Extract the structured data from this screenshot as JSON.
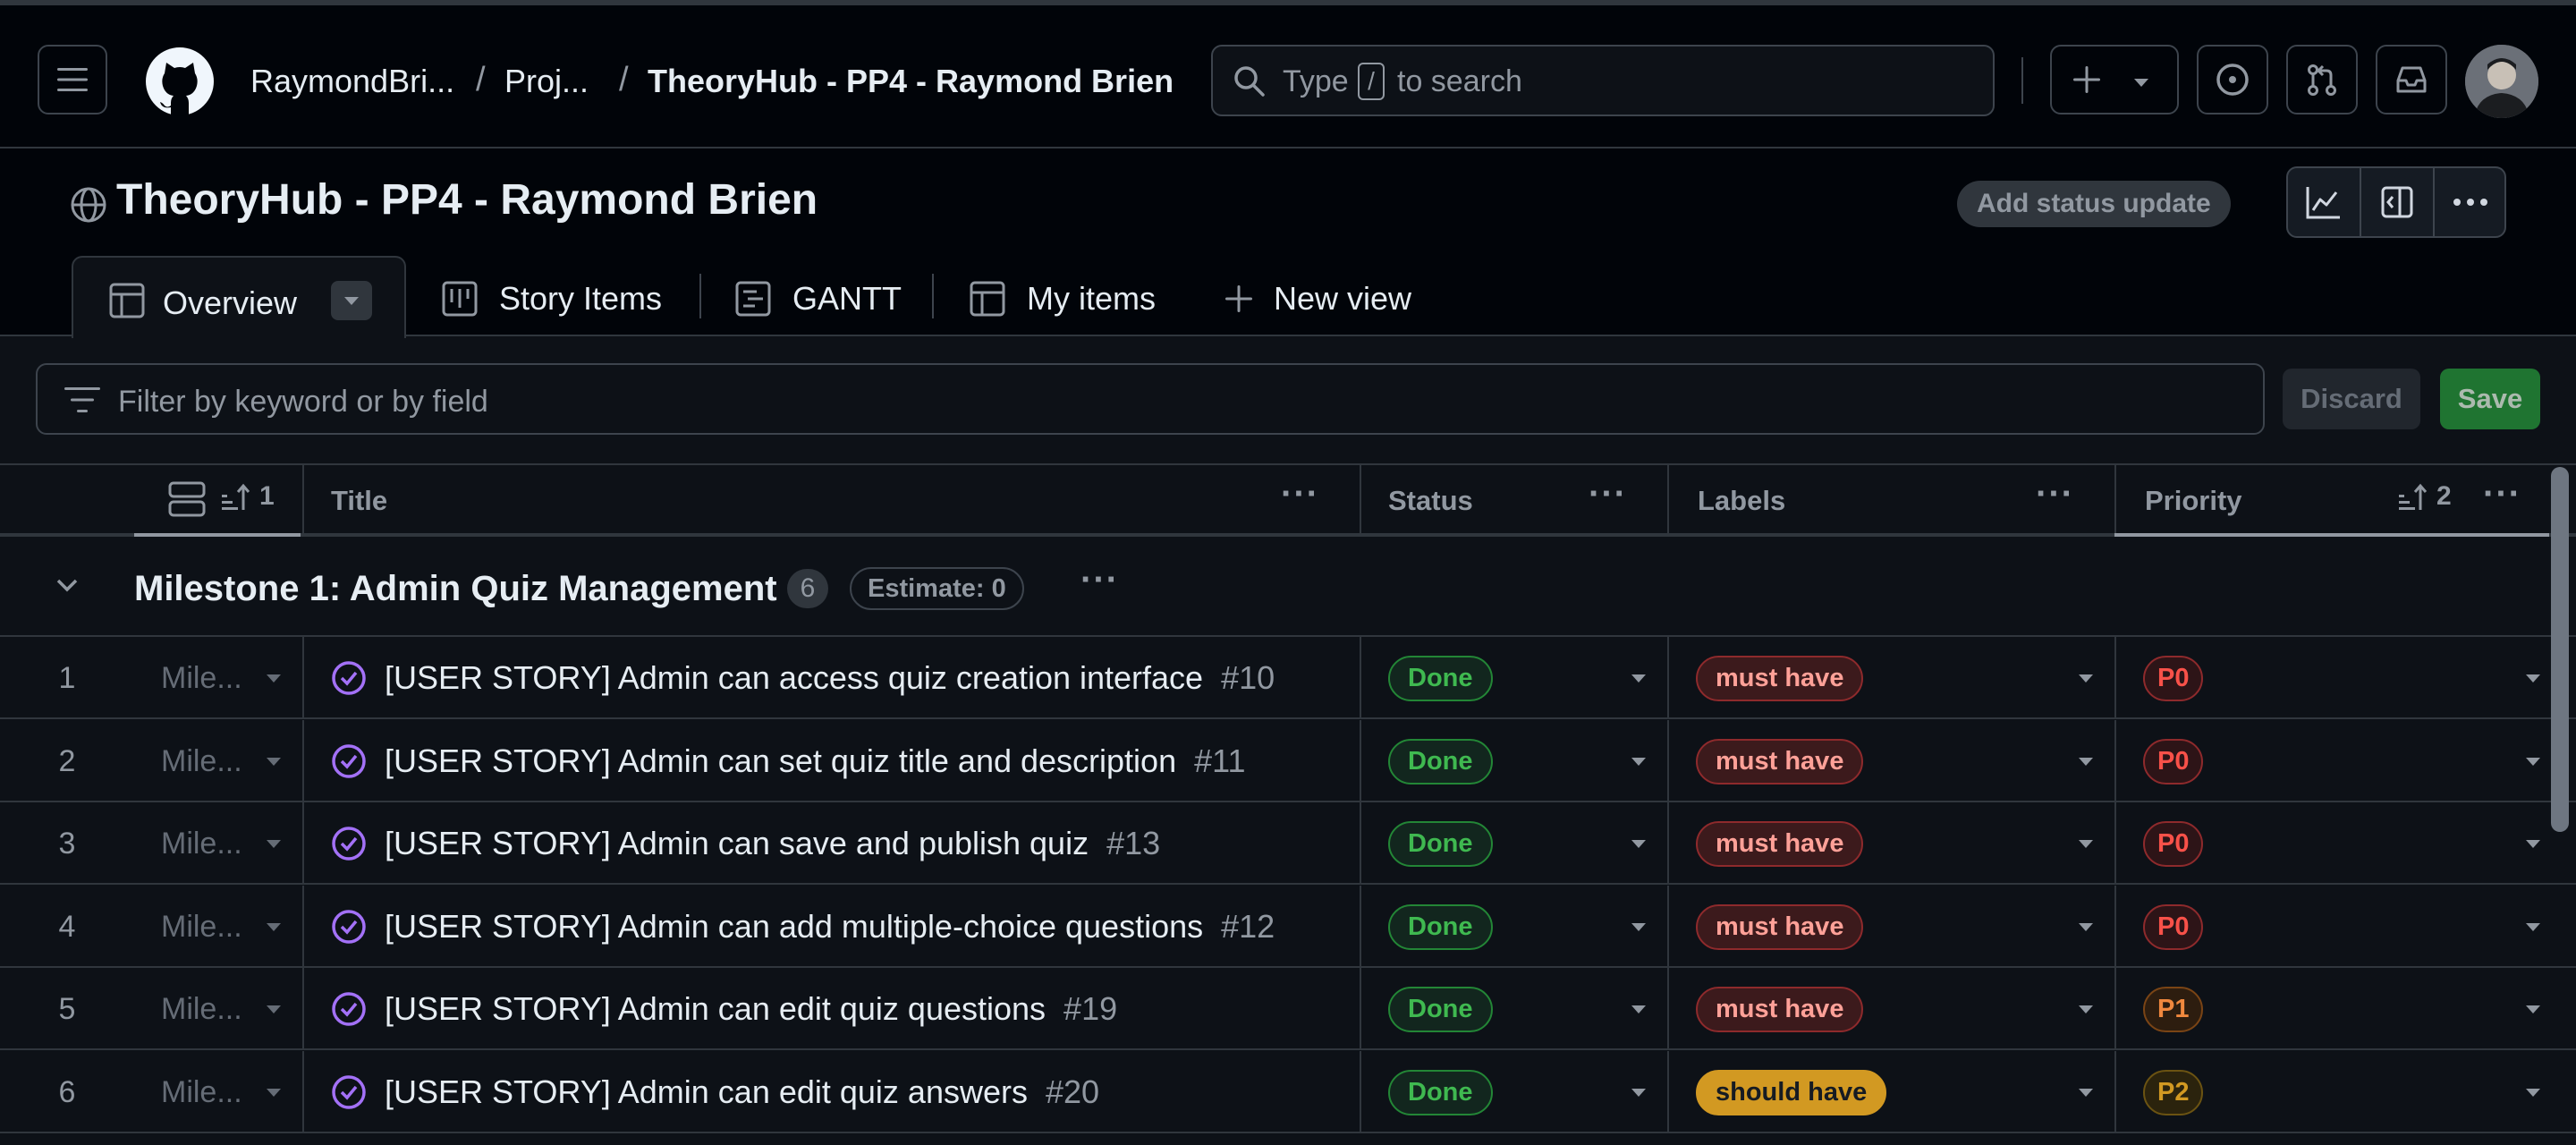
{
  "topbar": {
    "owner": "RaymondBri...",
    "projects": "Proj...",
    "repo_title": "TheoryHub - PP4 - Raymond Brien",
    "search_prefix": "Type",
    "search_key": "/",
    "search_suffix": "to search"
  },
  "project": {
    "title": "TheoryHub - PP4 - Raymond Brien",
    "status_update_label": "Add status update"
  },
  "tabs": [
    {
      "label": "Overview"
    },
    {
      "label": "Story Items"
    },
    {
      "label": "GANTT"
    },
    {
      "label": "My items"
    },
    {
      "label": "New view"
    }
  ],
  "filter": {
    "placeholder": "Filter by keyword or by field",
    "discard_label": "Discard",
    "save_label": "Save"
  },
  "columns": {
    "sort1": "1",
    "title": "Title",
    "status": "Status",
    "labels": "Labels",
    "priority": "Priority",
    "sort2": "2"
  },
  "group": {
    "name": "Milestone 1: Admin Quiz Management",
    "count": "6",
    "estimate": "Estimate: 0"
  },
  "rows": [
    {
      "num": "1",
      "milestone": "Mile...",
      "title": "[USER STORY] Admin can access quiz creation interface",
      "issue": "#10",
      "status": "Done",
      "label": "must have",
      "priority": "P0"
    },
    {
      "num": "2",
      "milestone": "Mile...",
      "title": "[USER STORY] Admin can set quiz title and description",
      "issue": "#11",
      "status": "Done",
      "label": "must have",
      "priority": "P0"
    },
    {
      "num": "3",
      "milestone": "Mile...",
      "title": "[USER STORY] Admin can save and publish quiz",
      "issue": "#13",
      "status": "Done",
      "label": "must have",
      "priority": "P0"
    },
    {
      "num": "4",
      "milestone": "Mile...",
      "title": "[USER STORY] Admin can add multiple-choice questions",
      "issue": "#12",
      "status": "Done",
      "label": "must have",
      "priority": "P0"
    },
    {
      "num": "5",
      "milestone": "Mile...",
      "title": "[USER STORY] Admin can edit quiz questions",
      "issue": "#19",
      "status": "Done",
      "label": "must have",
      "priority": "P1"
    },
    {
      "num": "6",
      "milestone": "Mile...",
      "title": "[USER STORY] Admin can edit quiz answers",
      "issue": "#20",
      "status": "Done",
      "label": "should have",
      "priority": "P2"
    }
  ],
  "icons": {
    "menu": "hamburger-icon",
    "logo": "github-logo-icon",
    "search": "search-icon",
    "plus": "plus-icon",
    "issues": "issue-opened-icon",
    "pulls": "git-pull-request-icon",
    "inbox": "inbox-icon",
    "globe": "globe-icon",
    "insights": "graph-icon",
    "panel": "sidebar-expand-icon",
    "filter": "filter-icon",
    "issue_closed": "issue-closed-icon"
  },
  "colors": {
    "background": "#0d1117",
    "done": "#3fb950",
    "must_have": "#ffa198",
    "should_have": "#d29922",
    "p0": "#f85149",
    "p1": "#f0883e",
    "p2": "#d29922",
    "issue_closed": "#a371f7",
    "save": "#238636"
  }
}
